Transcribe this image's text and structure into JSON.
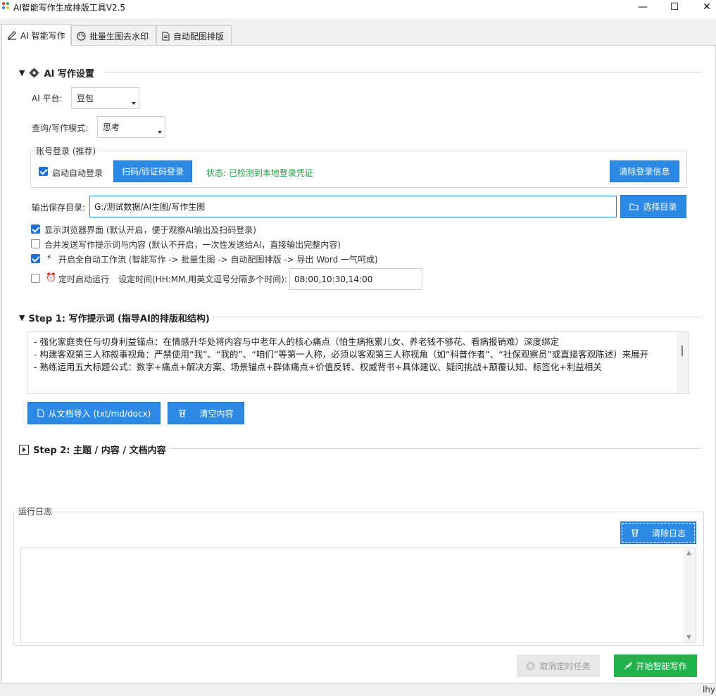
{
  "window": {
    "title": "AI智能写作生成排版工具V2.5",
    "minimize_glyph": "—",
    "maximize_glyph": "☐",
    "close_glyph": "✕"
  },
  "tabs": [
    {
      "label": "AI 智能写作",
      "icon": "pen-icon"
    },
    {
      "label": "批量生图去水印",
      "icon": "palette-icon"
    },
    {
      "label": "自动配图排版",
      "icon": "document-icon"
    }
  ],
  "ai_settings": {
    "header": "AI 写作设置",
    "platform_label": "AI 平台:",
    "platform_value": "豆包",
    "mode_label": "查询/写作模式:",
    "mode_value": "思考",
    "account_group_title": "账号登录 (推荐)",
    "auto_login_label": "启动自动登录",
    "auto_login_checked": true,
    "scan_login_button": "扫码/验证码登录",
    "login_status": "状态: 已检测到本地登录凭证",
    "clear_login_button": "清除登录信息",
    "output_dir_label": "输出保存目录:",
    "output_dir_value": "G:/测试数据/AI生图/写作生图",
    "choose_dir_button": "选择目录",
    "options": [
      {
        "label": "显示浏览器界面 (默认开启，便于观察AI输出及扫码登录)",
        "checked": true
      },
      {
        "label": "合并发送写作提示词与内容 (默认不开启，一次性发送给AI，直接输出完整内容)",
        "checked": false
      },
      {
        "label": "开启全自动工作流 (智能写作 -> 批量生图 -> 自动配图排版 -> 导出 Word 一气呵成)",
        "checked": true
      },
      {
        "label": "定时启动运行",
        "checked": false
      }
    ],
    "schedule_label": "设定时间(HH:MM,用英文逗号分隔多个时间):",
    "schedule_value": "08:00,10:30,14:00"
  },
  "step1": {
    "header": "Step 1: 写作提示词 (指导AI的排版和结构)",
    "lines": [
      " - 强化家庭责任与切身利益锚点：在情感升华处将内容与中老年人的核心痛点（怕生病拖累儿女、养老钱不够花、看病报销难）深度绑定",
      " - 构建客观第三人称叙事视角：严禁使用“我”、“我的”、“咱们”等第一人称，必须以客观第三人称视角（如“科普作者”、“社保观察员”或直接客观陈述）来展开",
      " - 熟练运用五大标题公式：数字+痛点+解决方案、场景锚点+群体痛点+价值反转、权威背书+具体建议、疑问挑战+颠覆认知、标签化+利益相关"
    ],
    "import_button": "从文档导入 (txt/md/docx)",
    "clear_button": "清空内容"
  },
  "step2": {
    "header": "Step 2: 主题 / 内容 / 文档内容"
  },
  "log": {
    "group_title": "运行日志",
    "clear_button": "清除日志",
    "content": ""
  },
  "footer": {
    "cancel_schedule_button": "取消定时任务",
    "start_button": "开始智能写作",
    "corner_text": "lhy"
  },
  "colors": {
    "accent_blue": "#2d89e6",
    "start_green": "#22b24c",
    "status_green": "#1f9d3b"
  }
}
